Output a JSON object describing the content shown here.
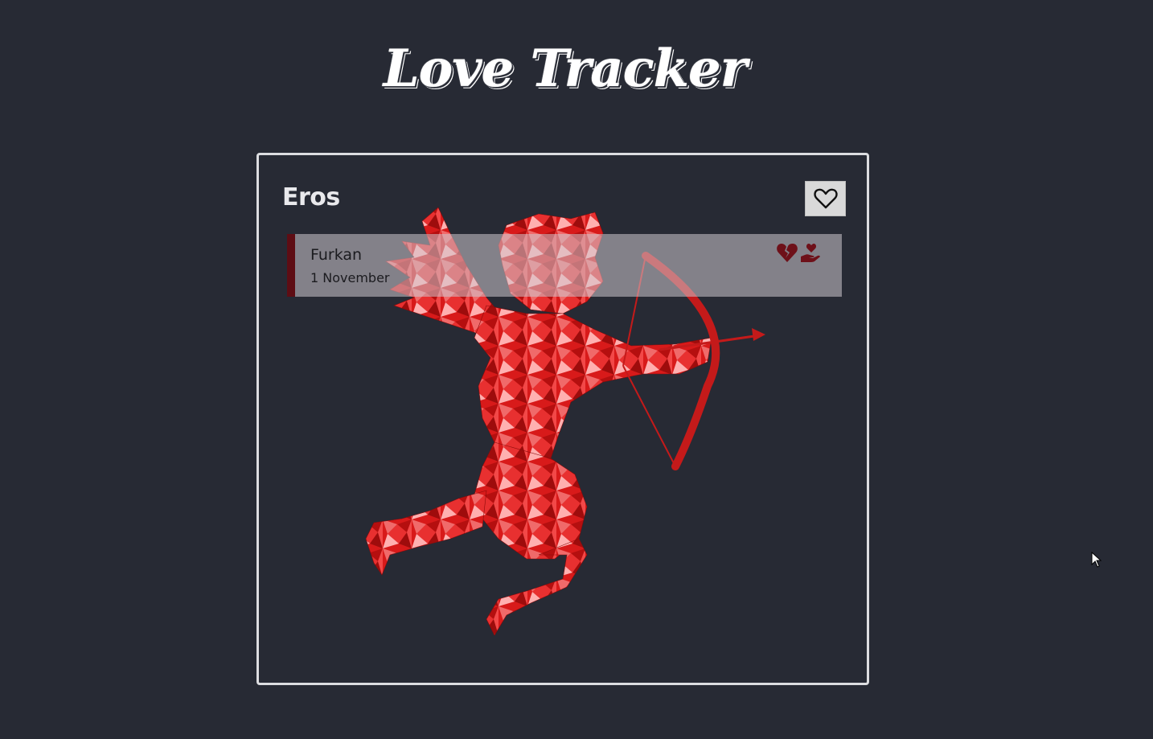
{
  "app": {
    "title": "Love Tracker"
  },
  "panel": {
    "title": "Eros",
    "add_button_icon": "heart-outline-icon"
  },
  "entries": [
    {
      "name": "Furkan",
      "date": "1 November",
      "actions": [
        "broken-heart-icon",
        "hand-holding-heart-icon"
      ]
    }
  ],
  "colors": {
    "background": "#272a34",
    "accent": "#5e0d14",
    "cupid_red": "#d91414",
    "text_light": "#e9e9ec"
  }
}
